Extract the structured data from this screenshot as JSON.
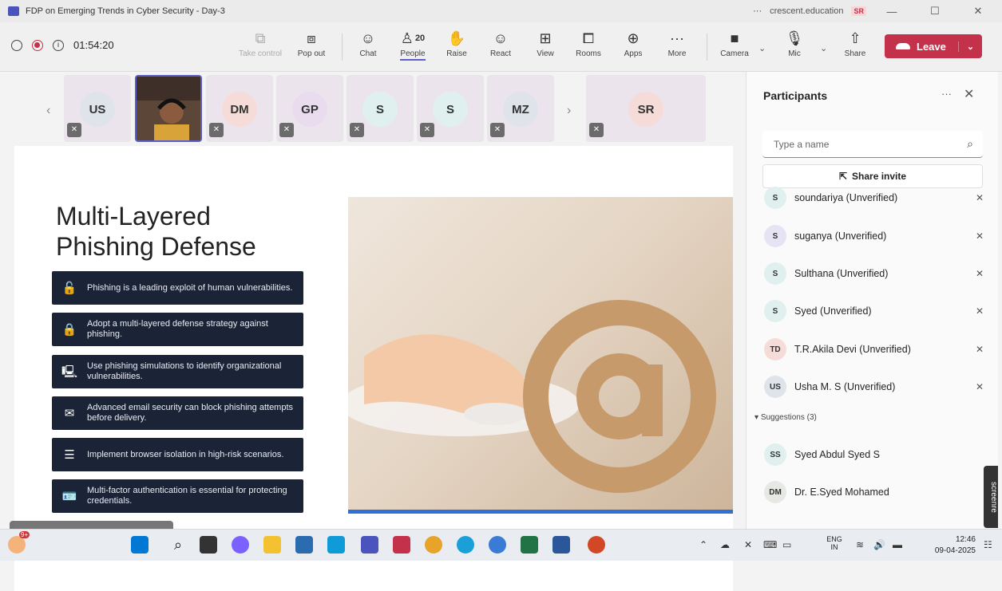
{
  "window": {
    "title": "FDP on Emerging Trends in Cyber Security - Day-3",
    "org": "crescent.education",
    "user_initials": "SR",
    "more": "···"
  },
  "toolbar": {
    "timer": "01:54:20",
    "buttons": {
      "take_control": "Take control",
      "pop_out": "Pop out",
      "chat": "Chat",
      "people": "People",
      "people_count": "20",
      "raise": "Raise",
      "react": "React",
      "view": "View",
      "rooms": "Rooms",
      "apps": "Apps",
      "more": "More",
      "camera": "Camera",
      "mic": "Mic",
      "share": "Share"
    },
    "leave": "Leave"
  },
  "gallery": [
    {
      "initials": "US",
      "color": "#dfe3ea"
    },
    {
      "initials": "",
      "color": "#4c3b33",
      "video": true
    },
    {
      "initials": "DM",
      "color": "#f6dcd8"
    },
    {
      "initials": "GP",
      "color": "#e9dcef"
    },
    {
      "initials": "S",
      "color": "#dff0ee"
    },
    {
      "initials": "S",
      "color": "#dff0ee"
    },
    {
      "initials": "MZ",
      "color": "#dfe3ea"
    },
    {
      "initials": "SR",
      "color": "#f6dcd8"
    }
  ],
  "slide": {
    "title_line1": "Multi-Layered",
    "title_line2": "Phishing Defense",
    "bullets": [
      {
        "icon": "🔓",
        "icon_name": "unlock-icon",
        "text": "Phishing is a leading exploit of human vulnerabilities."
      },
      {
        "icon": "🔒",
        "icon_name": "lock-icon",
        "text": "Adopt a multi-layered defense strategy against phishing."
      },
      {
        "icon": "🖳",
        "icon_name": "devices-icon",
        "text": "Use phishing simulations to identify organizational vulnerabilities."
      },
      {
        "icon": "✉",
        "icon_name": "envelope-icon",
        "text": "Advanced email security can block phishing attempts before delivery."
      },
      {
        "icon": "☰",
        "icon_name": "server-icon",
        "text": "Implement browser isolation in high-risk scenarios."
      },
      {
        "icon": "🪪",
        "icon_name": "id-card-icon",
        "text": "Multi-factor authentication is essential for protecting credentials."
      }
    ]
  },
  "participants": {
    "heading": "Participants",
    "search_placeholder": "Type a name",
    "share_invite": "Share invite",
    "list": [
      {
        "initials": "S",
        "name": "soundariya (Unverified)",
        "color": "#dff0ee"
      },
      {
        "initials": "S",
        "name": "suganya (Unverified)",
        "color": "#e6e3f4"
      },
      {
        "initials": "S",
        "name": "Sulthana (Unverified)",
        "color": "#dff0ee"
      },
      {
        "initials": "S",
        "name": "Syed (Unverified)",
        "color": "#dff0ee"
      },
      {
        "initials": "TD",
        "name": "T.R.Akila Devi (Unverified)",
        "color": "#f6dcd8"
      },
      {
        "initials": "US",
        "name": "Usha M. S (Unverified)",
        "color": "#dfe3ea"
      }
    ],
    "suggestions_label": "Suggestions (3)",
    "suggestions": [
      {
        "initials": "SS",
        "name": "Syed Abdul Syed S",
        "color": "#dff0ee"
      },
      {
        "initials": "DM",
        "name": "Dr. E.Syed Mohamed",
        "color": "#e6e8e4"
      }
    ]
  },
  "taskbar": {
    "lang_line1": "ENG",
    "lang_line2": "IN",
    "time": "12:46",
    "date": "09-04-2025",
    "badge": "9+"
  },
  "recorder": "screenre"
}
